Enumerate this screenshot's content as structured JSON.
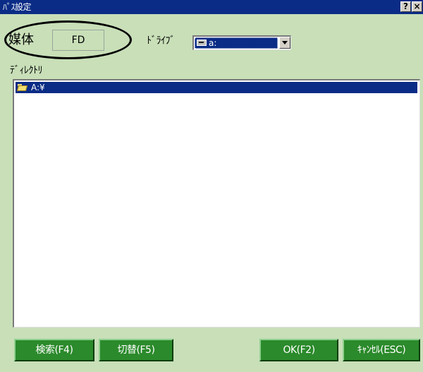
{
  "window": {
    "title": "ﾊﾟｽ設定",
    "help_button": "?",
    "close_button": "×"
  },
  "media": {
    "label": "媒体",
    "value": "FD"
  },
  "drive": {
    "label": "ﾄﾞﾗｲﾌﾞ",
    "selected": "a:",
    "icon": "drive-icon"
  },
  "directory": {
    "label": "ﾃﾞｨﾚｸﾄﾘ",
    "items": [
      {
        "label": "A:¥",
        "icon": "folder-open-icon",
        "selected": true
      }
    ]
  },
  "buttons": {
    "search": "検索(F4)",
    "switch": "切替(F5)",
    "ok": "OK(F2)",
    "cancel": "ｷｬﾝｾﾙ(ESC)"
  },
  "colors": {
    "titlebar": "#0a2c86",
    "dialog_background": "#c8dfb8",
    "button_green": "#2b8a2b",
    "selection": "#0a2c86"
  }
}
